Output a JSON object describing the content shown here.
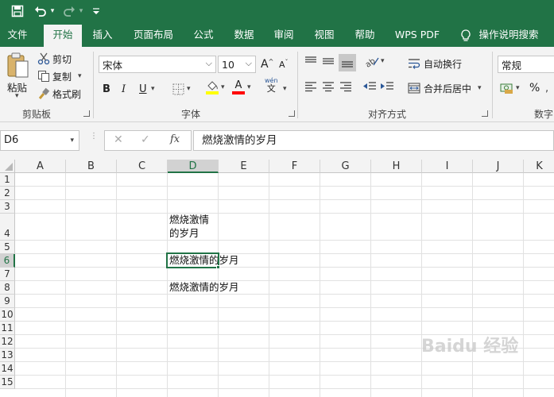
{
  "quick_access": {
    "save_icon": "save-icon",
    "undo_icon": "undo-icon",
    "redo_icon": "redo-icon",
    "customize_icon": "customize-icon"
  },
  "tabs": [
    {
      "label": "文件"
    },
    {
      "label": "开始"
    },
    {
      "label": "插入"
    },
    {
      "label": "页面布局"
    },
    {
      "label": "公式"
    },
    {
      "label": "数据"
    },
    {
      "label": "审阅"
    },
    {
      "label": "视图"
    },
    {
      "label": "帮助"
    },
    {
      "label": "WPS PDF"
    }
  ],
  "tell_me": "操作说明搜索",
  "ribbon": {
    "clipboard": {
      "paste": "粘贴",
      "cut": "剪切",
      "copy": "复制",
      "format_painter": "格式刷",
      "label": "剪贴板"
    },
    "font": {
      "name": "宋体",
      "size": "10",
      "grow": "A",
      "shrink": "A",
      "bold": "B",
      "italic": "I",
      "underline": "U",
      "phonetic_top": "wén",
      "phonetic_bottom": "文",
      "font_color_letter": "A",
      "label": "字体",
      "highlight_color": "#ffff00",
      "font_color": "#ff0000"
    },
    "alignment": {
      "wrap_text": "自动换行",
      "merge_center": "合并后居中",
      "label": "对齐方式"
    },
    "number": {
      "format": "常规",
      "percent": "%",
      "label": "数字"
    }
  },
  "formula_bar": {
    "name_box": "D6",
    "fx": "fx",
    "content": "燃烧激情的岁月"
  },
  "columns": [
    "A",
    "B",
    "C",
    "D",
    "E",
    "F",
    "G",
    "H",
    "I",
    "J",
    "K"
  ],
  "rows": [
    "1",
    "2",
    "3",
    "4",
    "5",
    "6",
    "7",
    "8",
    "9",
    "10",
    "11",
    "12",
    "13",
    "14",
    "15"
  ],
  "cells": {
    "d4_line1": "燃烧激情",
    "d4_line2": "的岁月",
    "d6": "燃烧激情的岁月",
    "d8": "燃烧激情的岁月"
  },
  "watermark": "Baidu 经验"
}
